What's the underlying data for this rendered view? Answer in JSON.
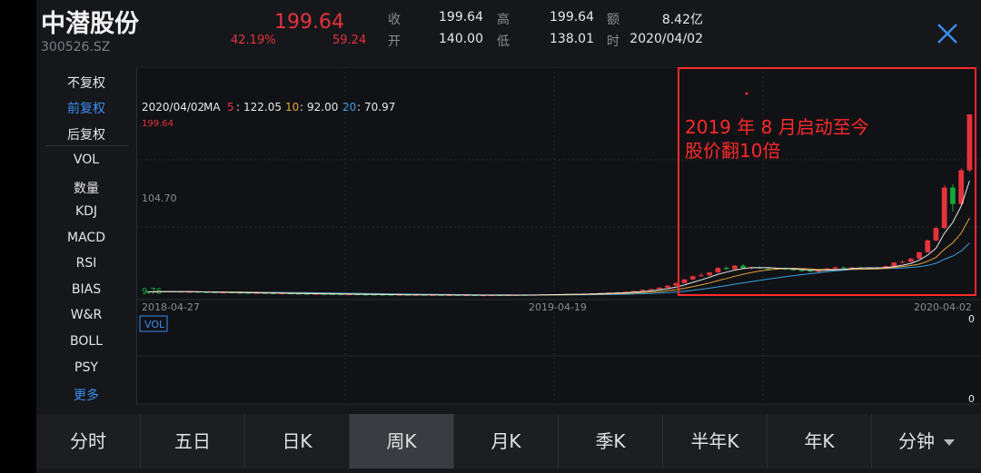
{
  "header": {
    "stock_name": "中潜股份",
    "stock_code": "300526.SZ",
    "price": "199.64",
    "change_pct": "42.19%",
    "change_amt": "59.24",
    "stats": [
      {
        "label": "收",
        "value": "199.64"
      },
      {
        "label": "高",
        "value": "199.64"
      },
      {
        "label": "额",
        "value": "8.42亿"
      },
      {
        "label": "开",
        "value": "140.00"
      },
      {
        "label": "低",
        "value": "138.01"
      },
      {
        "label": "时",
        "value": "2020/04/02"
      }
    ]
  },
  "menu": {
    "items": [
      {
        "label": "不复权",
        "active": false
      },
      {
        "label": "前复权",
        "active": true
      },
      {
        "label": "后复权",
        "active": false
      },
      {
        "label": "VOL",
        "active": false
      },
      {
        "label": "数量",
        "active": false
      },
      {
        "label": "KDJ",
        "active": false
      },
      {
        "label": "MACD",
        "active": false
      },
      {
        "label": "RSI",
        "active": false
      },
      {
        "label": "BIAS",
        "active": false
      },
      {
        "label": "W&R",
        "active": false
      },
      {
        "label": "BOLL",
        "active": false
      },
      {
        "label": "PSY",
        "active": false
      },
      {
        "label": "更多",
        "active": true
      }
    ]
  },
  "tabs": [
    {
      "label": "分时",
      "active": false
    },
    {
      "label": "五日",
      "active": false
    },
    {
      "label": "日K",
      "active": false
    },
    {
      "label": "周K",
      "active": true
    },
    {
      "label": "月K",
      "active": false
    },
    {
      "label": "季K",
      "active": false
    },
    {
      "label": "半年K",
      "active": false
    },
    {
      "label": "年K",
      "active": false
    },
    {
      "label": "分钟",
      "active": false
    }
  ],
  "chart_data": {
    "type": "candlestick",
    "ma_info": {
      "date": "2020/04/02",
      "label": "MA",
      "ma5_label": "5",
      "ma5_value": "122.05",
      "ma10_label": "10",
      "ma10_value": "92.00",
      "ma20_label": "20",
      "ma20_value": "70.97"
    },
    "y_labels": {
      "top": "199.64",
      "mid": "104.70",
      "bottom": "9.76"
    },
    "ylim": [
      9.76,
      199.64
    ],
    "x_ticks": [
      "2018-04-27",
      "2019-04-19",
      "2020-04-02"
    ],
    "volume_label": "VOL",
    "volume_axis_top": "0",
    "volume_axis_bottom": "0",
    "annotation": {
      "line1": "2019 年 8 月启动至今",
      "line2": "股价翻10倍"
    },
    "colors": {
      "up": "#e5333c",
      "down": "#14a83b",
      "ma5": "#e8e8e8",
      "ma10": "#e8a33a",
      "ma20": "#3aa0e0",
      "annotation": "#ff2a2a"
    },
    "candles": [
      {
        "o": 10.4,
        "h": 10.9,
        "l": 10.0,
        "c": 10.2
      },
      {
        "o": 10.2,
        "h": 10.6,
        "l": 9.9,
        "c": 10.5
      },
      {
        "o": 10.5,
        "h": 11.0,
        "l": 10.3,
        "c": 10.8
      },
      {
        "o": 10.8,
        "h": 11.1,
        "l": 10.4,
        "c": 10.6
      },
      {
        "o": 10.6,
        "h": 10.8,
        "l": 10.0,
        "c": 10.1
      },
      {
        "o": 10.1,
        "h": 10.4,
        "l": 9.8,
        "c": 10.3
      },
      {
        "o": 10.3,
        "h": 10.5,
        "l": 9.9,
        "c": 10.0
      },
      {
        "o": 10.0,
        "h": 10.2,
        "l": 9.6,
        "c": 9.8
      },
      {
        "o": 9.8,
        "h": 10.0,
        "l": 9.4,
        "c": 9.6
      },
      {
        "o": 9.6,
        "h": 9.9,
        "l": 9.3,
        "c": 9.7
      },
      {
        "o": 9.7,
        "h": 9.9,
        "l": 9.2,
        "c": 9.4
      },
      {
        "o": 9.4,
        "h": 9.6,
        "l": 9.0,
        "c": 9.2
      },
      {
        "o": 9.2,
        "h": 9.4,
        "l": 8.8,
        "c": 9.0
      },
      {
        "o": 9.0,
        "h": 9.3,
        "l": 8.7,
        "c": 9.1
      },
      {
        "o": 9.1,
        "h": 9.2,
        "l": 8.6,
        "c": 8.8
      },
      {
        "o": 8.8,
        "h": 9.0,
        "l": 8.4,
        "c": 8.6
      },
      {
        "o": 8.6,
        "h": 8.9,
        "l": 8.3,
        "c": 8.7
      },
      {
        "o": 8.7,
        "h": 8.8,
        "l": 8.2,
        "c": 8.4
      },
      {
        "o": 8.4,
        "h": 8.6,
        "l": 8.0,
        "c": 8.2
      },
      {
        "o": 8.2,
        "h": 8.4,
        "l": 7.9,
        "c": 8.0
      },
      {
        "o": 8.0,
        "h": 8.3,
        "l": 7.8,
        "c": 8.1
      },
      {
        "o": 8.1,
        "h": 8.2,
        "l": 7.7,
        "c": 7.9
      },
      {
        "o": 7.9,
        "h": 8.1,
        "l": 7.6,
        "c": 7.8
      },
      {
        "o": 7.8,
        "h": 8.0,
        "l": 7.5,
        "c": 7.6
      },
      {
        "o": 7.6,
        "h": 7.9,
        "l": 7.4,
        "c": 7.7
      },
      {
        "o": 7.7,
        "h": 7.8,
        "l": 7.3,
        "c": 7.5
      },
      {
        "o": 7.5,
        "h": 7.7,
        "l": 7.2,
        "c": 7.4
      },
      {
        "o": 7.4,
        "h": 7.6,
        "l": 7.1,
        "c": 7.3
      },
      {
        "o": 7.3,
        "h": 7.5,
        "l": 7.0,
        "c": 7.2
      },
      {
        "o": 7.2,
        "h": 7.4,
        "l": 6.9,
        "c": 7.1
      },
      {
        "o": 7.1,
        "h": 7.3,
        "l": 6.9,
        "c": 7.2
      },
      {
        "o": 7.2,
        "h": 7.3,
        "l": 6.8,
        "c": 7.0
      },
      {
        "o": 7.0,
        "h": 7.2,
        "l": 6.8,
        "c": 7.1
      },
      {
        "o": 7.1,
        "h": 7.2,
        "l": 6.7,
        "c": 6.9
      },
      {
        "o": 6.9,
        "h": 7.1,
        "l": 6.7,
        "c": 7.0
      },
      {
        "o": 7.0,
        "h": 7.1,
        "l": 6.6,
        "c": 6.8
      },
      {
        "o": 6.8,
        "h": 7.0,
        "l": 6.6,
        "c": 6.9
      },
      {
        "o": 6.9,
        "h": 7.0,
        "l": 6.5,
        "c": 6.7
      },
      {
        "o": 6.7,
        "h": 6.9,
        "l": 6.5,
        "c": 6.8
      },
      {
        "o": 6.8,
        "h": 6.9,
        "l": 6.4,
        "c": 6.6
      },
      {
        "o": 6.6,
        "h": 6.8,
        "l": 6.4,
        "c": 6.7
      },
      {
        "o": 6.7,
        "h": 6.9,
        "l": 6.5,
        "c": 6.8
      },
      {
        "o": 6.8,
        "h": 7.0,
        "l": 6.6,
        "c": 6.7
      },
      {
        "o": 6.7,
        "h": 6.9,
        "l": 6.5,
        "c": 6.8
      },
      {
        "o": 6.8,
        "h": 7.1,
        "l": 6.6,
        "c": 7.0
      },
      {
        "o": 7.0,
        "h": 7.2,
        "l": 6.8,
        "c": 6.9
      },
      {
        "o": 6.9,
        "h": 7.2,
        "l": 6.7,
        "c": 7.1
      },
      {
        "o": 7.1,
        "h": 7.5,
        "l": 7.0,
        "c": 7.4
      },
      {
        "o": 7.4,
        "h": 7.7,
        "l": 7.2,
        "c": 7.6
      },
      {
        "o": 7.6,
        "h": 7.9,
        "l": 7.3,
        "c": 7.5
      },
      {
        "o": 7.5,
        "h": 8.0,
        "l": 7.4,
        "c": 7.9
      },
      {
        "o": 7.9,
        "h": 8.3,
        "l": 7.7,
        "c": 8.2
      },
      {
        "o": 8.2,
        "h": 8.6,
        "l": 7.9,
        "c": 8.0
      },
      {
        "o": 8.0,
        "h": 8.8,
        "l": 7.9,
        "c": 8.7
      },
      {
        "o": 8.7,
        "h": 9.2,
        "l": 8.5,
        "c": 9.0
      },
      {
        "o": 9.0,
        "h": 9.8,
        "l": 8.8,
        "c": 9.6
      },
      {
        "o": 9.6,
        "h": 10.2,
        "l": 9.3,
        "c": 9.4
      },
      {
        "o": 9.4,
        "h": 10.6,
        "l": 9.3,
        "c": 10.4
      },
      {
        "o": 10.4,
        "h": 11.4,
        "l": 10.2,
        "c": 11.2
      },
      {
        "o": 11.2,
        "h": 12.6,
        "l": 11.0,
        "c": 12.4
      },
      {
        "o": 12.4,
        "h": 13.6,
        "l": 12.0,
        "c": 13.2
      },
      {
        "o": 13.2,
        "h": 15.0,
        "l": 13.0,
        "c": 14.8
      },
      {
        "o": 14.8,
        "h": 17.2,
        "l": 14.5,
        "c": 17.0
      },
      {
        "o": 17.0,
        "h": 20.0,
        "l": 16.6,
        "c": 19.6
      },
      {
        "o": 19.6,
        "h": 24.0,
        "l": 19.2,
        "c": 23.5
      },
      {
        "o": 23.5,
        "h": 27.5,
        "l": 22.8,
        "c": 27.0
      },
      {
        "o": 27.0,
        "h": 30.5,
        "l": 26.4,
        "c": 28.0
      },
      {
        "o": 28.0,
        "h": 31.5,
        "l": 27.2,
        "c": 31.0
      },
      {
        "o": 31.0,
        "h": 36.5,
        "l": 30.5,
        "c": 35.8
      },
      {
        "o": 35.8,
        "h": 37.5,
        "l": 33.8,
        "c": 34.6
      },
      {
        "o": 34.6,
        "h": 39.0,
        "l": 34.0,
        "c": 38.2
      },
      {
        "o": 38.2,
        "h": 39.8,
        "l": 35.0,
        "c": 35.8
      },
      {
        "o": 35.8,
        "h": 37.0,
        "l": 34.2,
        "c": 36.4
      },
      {
        "o": 36.4,
        "h": 37.6,
        "l": 34.8,
        "c": 35.2
      },
      {
        "o": 35.2,
        "h": 36.2,
        "l": 33.8,
        "c": 34.8
      },
      {
        "o": 34.8,
        "h": 36.0,
        "l": 33.6,
        "c": 35.6
      },
      {
        "o": 35.6,
        "h": 36.4,
        "l": 33.5,
        "c": 34.2
      },
      {
        "o": 34.2,
        "h": 35.4,
        "l": 32.8,
        "c": 33.4
      },
      {
        "o": 33.4,
        "h": 34.6,
        "l": 32.0,
        "c": 32.6
      },
      {
        "o": 32.6,
        "h": 33.8,
        "l": 31.2,
        "c": 31.8
      },
      {
        "o": 31.8,
        "h": 33.6,
        "l": 30.6,
        "c": 33.0
      },
      {
        "o": 33.0,
        "h": 35.8,
        "l": 32.6,
        "c": 35.2
      },
      {
        "o": 35.2,
        "h": 37.2,
        "l": 34.4,
        "c": 36.4
      },
      {
        "o": 36.4,
        "h": 37.4,
        "l": 35.0,
        "c": 35.6
      },
      {
        "o": 35.6,
        "h": 36.8,
        "l": 34.6,
        "c": 36.2
      },
      {
        "o": 36.2,
        "h": 37.0,
        "l": 35.0,
        "c": 35.4
      },
      {
        "o": 35.4,
        "h": 36.6,
        "l": 34.8,
        "c": 36.0
      },
      {
        "o": 36.0,
        "h": 37.0,
        "l": 35.2,
        "c": 35.8
      },
      {
        "o": 35.8,
        "h": 38.2,
        "l": 35.4,
        "c": 37.8
      },
      {
        "o": 37.8,
        "h": 42.0,
        "l": 37.4,
        "c": 41.6
      },
      {
        "o": 41.6,
        "h": 44.0,
        "l": 40.8,
        "c": 42.4
      },
      {
        "o": 42.4,
        "h": 46.5,
        "l": 41.8,
        "c": 45.8
      },
      {
        "o": 45.8,
        "h": 53.0,
        "l": 45.2,
        "c": 52.6
      },
      {
        "o": 52.6,
        "h": 66.0,
        "l": 52.0,
        "c": 65.2
      },
      {
        "o": 65.2,
        "h": 80.0,
        "l": 64.0,
        "c": 78.4
      },
      {
        "o": 78.4,
        "h": 124.0,
        "l": 77.0,
        "c": 121.6
      },
      {
        "o": 121.6,
        "h": 125.0,
        "l": 96.0,
        "c": 104.0
      },
      {
        "o": 104.0,
        "h": 142.0,
        "l": 103.0,
        "c": 140.0
      },
      {
        "o": 140.0,
        "h": 199.64,
        "l": 138.01,
        "c": 199.64
      }
    ]
  }
}
